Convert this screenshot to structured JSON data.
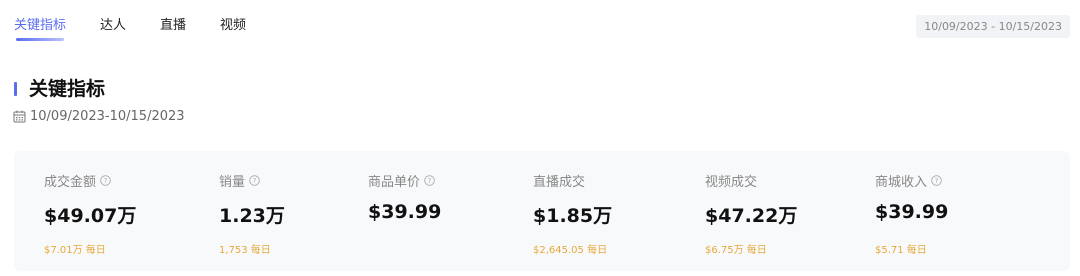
{
  "tabs": [
    {
      "label": "关键指标",
      "active": true
    },
    {
      "label": "达人",
      "active": false
    },
    {
      "label": "直播",
      "active": false
    },
    {
      "label": "视频",
      "active": false
    }
  ],
  "date_range": "10/09/2023 - 10/15/2023",
  "section": {
    "title": "关键指标",
    "date": "10/09/2023-10/15/2023"
  },
  "metrics": [
    {
      "label": "成交金额",
      "value": "$49.07万",
      "daily": "$7.01万 每日",
      "help": true
    },
    {
      "label": "销量",
      "value": "1.23万",
      "daily": "1,753 每日",
      "help": true
    },
    {
      "label": "商品单价",
      "value": "$39.99",
      "daily": "",
      "help": true
    },
    {
      "label": "直播成交",
      "value": "$1.85万",
      "daily": "$2,645.05 每日",
      "help": false
    },
    {
      "label": "视频成交",
      "value": "$47.22万",
      "daily": "$6.75万 每日",
      "help": false
    },
    {
      "label": "商城收入",
      "value": "$39.99",
      "daily": "$5.71 每日",
      "help": true
    }
  ],
  "colors": {
    "accent": "#5a6cf0",
    "daily_text": "#e6a93a",
    "panel_bg": "#f8f9fb"
  },
  "icons": {
    "calendar": "calendar-icon",
    "help": "help-circle-icon"
  }
}
